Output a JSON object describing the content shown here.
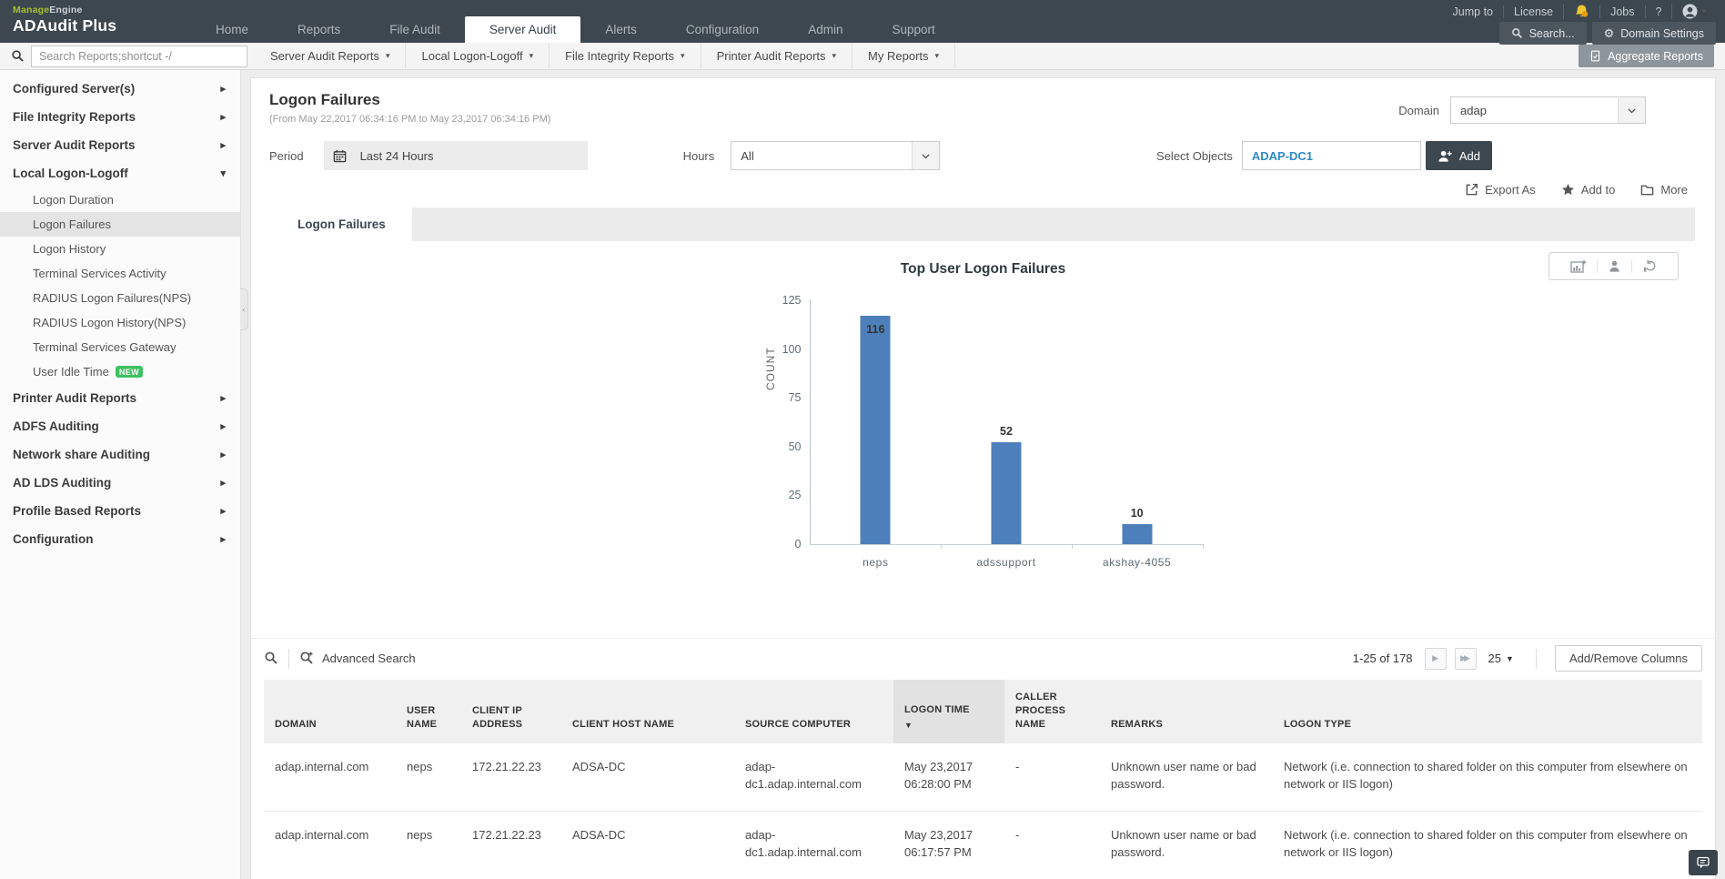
{
  "brand": {
    "manage": "Manage",
    "engine": "Engine",
    "product": "ADAudit Plus"
  },
  "topnav": {
    "tabs": [
      {
        "label": "Home"
      },
      {
        "label": "Reports"
      },
      {
        "label": "File Audit"
      },
      {
        "label": "Server Audit",
        "active": true
      },
      {
        "label": "Alerts"
      },
      {
        "label": "Configuration"
      },
      {
        "label": "Admin"
      },
      {
        "label": "Support"
      }
    ],
    "jump_to": "Jump to",
    "license": "License",
    "jobs": "Jobs",
    "help": "?",
    "search_button": "Search...",
    "domain_settings": "Domain Settings"
  },
  "menubar": {
    "search_placeholder": "Search Reports;shortcut -/",
    "menus": [
      {
        "label": "Server Audit Reports"
      },
      {
        "label": "Local Logon-Logoff"
      },
      {
        "label": "File Integrity Reports"
      },
      {
        "label": "Printer Audit Reports"
      },
      {
        "label": "My Reports"
      }
    ],
    "aggregate_reports": "Aggregate Reports"
  },
  "sidebar": {
    "items": [
      {
        "label": "Configured Server(s)",
        "type": "group"
      },
      {
        "label": "File Integrity Reports",
        "type": "group"
      },
      {
        "label": "Server Audit Reports",
        "type": "group"
      },
      {
        "label": "Local Logon-Logoff",
        "type": "group-open"
      },
      {
        "label": "Logon Duration",
        "type": "sub"
      },
      {
        "label": "Logon Failures",
        "type": "sub",
        "selected": true
      },
      {
        "label": "Logon History",
        "type": "sub"
      },
      {
        "label": "Terminal Services Activity",
        "type": "sub"
      },
      {
        "label": "RADIUS Logon Failures(NPS)",
        "type": "sub"
      },
      {
        "label": "RADIUS Logon History(NPS)",
        "type": "sub"
      },
      {
        "label": "Terminal Services Gateway",
        "type": "sub"
      },
      {
        "label": "User Idle Time",
        "type": "sub",
        "badge": "NEW"
      },
      {
        "label": "Printer Audit Reports",
        "type": "group"
      },
      {
        "label": "ADFS Auditing",
        "type": "group"
      },
      {
        "label": "Network share Auditing",
        "type": "group"
      },
      {
        "label": "AD LDS Auditing",
        "type": "group"
      },
      {
        "label": "Profile Based Reports",
        "type": "group"
      },
      {
        "label": "Configuration",
        "type": "group"
      }
    ]
  },
  "report": {
    "title": "Logon Failures",
    "date_range": "(From May 22,2017 06:34:16 PM to May 23,2017 06:34:16 PM)",
    "domain_label": "Domain",
    "domain_value": "adap",
    "period_label": "Period",
    "period_value": "Last 24 Hours",
    "hours_label": "Hours",
    "hours_value": "All",
    "select_objects_label": "Select Objects",
    "select_objects_value": "ADAP-DC1",
    "add_button": "Add",
    "export_as": "Export As",
    "add_to": "Add to",
    "more": "More",
    "tab": "Logon Failures"
  },
  "chart_data": {
    "type": "bar",
    "title": "Top User Logon Failures",
    "ylabel": "COUNT",
    "xlabel": "",
    "categories": [
      "neps",
      "adssupport",
      "akshay-4055"
    ],
    "values": [
      116,
      52,
      10
    ],
    "ylim": [
      0,
      125
    ],
    "yticks": [
      0,
      25,
      50,
      75,
      100,
      125
    ],
    "bar_color": "#4d80ba",
    "grid": false,
    "legend": false
  },
  "table": {
    "advanced_search": "Advanced Search",
    "pagination": "1-25 of 178",
    "page_size": "25",
    "add_remove_columns": "Add/Remove Columns",
    "columns": [
      {
        "label": "DOMAIN"
      },
      {
        "label": "USER NAME"
      },
      {
        "label": "CLIENT IP ADDRESS"
      },
      {
        "label": "CLIENT HOST NAME"
      },
      {
        "label": "SOURCE COMPUTER"
      },
      {
        "label": "LOGON TIME",
        "sorted": true
      },
      {
        "label": "CALLER PROCESS NAME"
      },
      {
        "label": "REMARKS"
      },
      {
        "label": "LOGON TYPE"
      }
    ],
    "rows": [
      {
        "domain": "adap.internal.com",
        "user": "neps",
        "ip": "172.21.22.23",
        "host": "ADSA-DC",
        "source": "adap-dc1.adap.internal.com",
        "time": "May 23,2017 06:28:00 PM",
        "caller": "-",
        "remarks": "Unknown user name or bad password.",
        "logon_type": "Network (i.e. connection to shared folder on this computer from elsewhere on network or IIS logon)"
      },
      {
        "domain": "adap.internal.com",
        "user": "neps",
        "ip": "172.21.22.23",
        "host": "ADSA-DC",
        "source": "adap-dc1.adap.internal.com",
        "time": "May 23,2017 06:17:57 PM",
        "caller": "-",
        "remarks": "Unknown user name or bad password.",
        "logon_type": "Network (i.e. connection to shared folder on this computer from elsewhere on network or IIS logon)"
      }
    ]
  }
}
